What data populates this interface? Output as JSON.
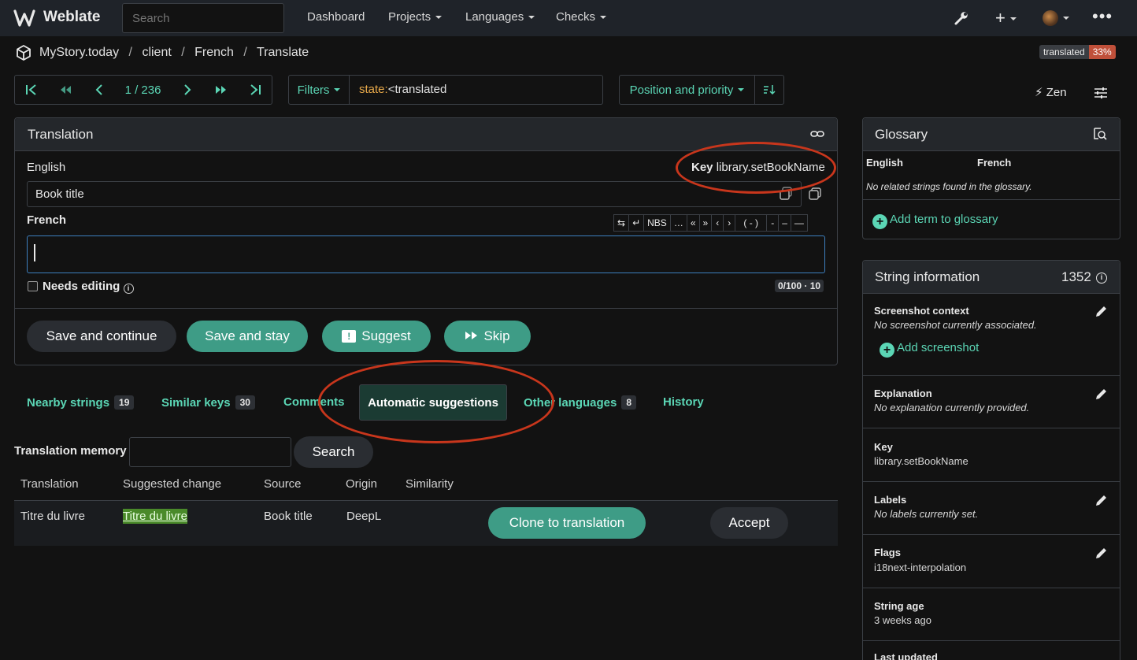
{
  "navbar": {
    "brand": "Weblate",
    "search_placeholder": "Search",
    "menu": [
      "Dashboard",
      "Projects",
      "Languages",
      "Checks"
    ]
  },
  "breadcrumb": [
    "MyStory.today",
    "client",
    "French",
    "Translate"
  ],
  "progress": {
    "label": "translated",
    "percent_text": "33%",
    "percent": 33
  },
  "nav_counter": "1 / 236",
  "filters": {
    "label": "Filters",
    "query_key": "state:",
    "query_value": "<translated"
  },
  "sort": {
    "label": "Position and priority"
  },
  "zen": {
    "label": "Zen"
  },
  "translation_panel": {
    "title": "Translation",
    "source_lang": "English",
    "key_label": "Key",
    "key_value": "library.setBookName",
    "source_text": "Book title",
    "target_lang": "French",
    "special_chars": [
      "⇆",
      "↵",
      "NBS",
      "…",
      "«",
      "»",
      "‹",
      "›",
      "( - )",
      "-",
      "–",
      "—"
    ],
    "needs_editing_label": "Needs editing",
    "char_counter": "0/100 · 10",
    "buttons": {
      "save_continue": "Save and continue",
      "save_stay": "Save and stay",
      "suggest": "Suggest",
      "skip": "Skip"
    }
  },
  "tabs": [
    {
      "label": "Nearby strings",
      "count": "19"
    },
    {
      "label": "Similar keys",
      "count": "30"
    },
    {
      "label": "Comments",
      "count": ""
    },
    {
      "label": "Automatic suggestions",
      "count": ""
    },
    {
      "label": "Other languages",
      "count": "8"
    },
    {
      "label": "History",
      "count": ""
    }
  ],
  "memory": {
    "label": "Translation memory",
    "search_button": "Search"
  },
  "suggestions_table": {
    "headers": [
      "Translation",
      "Suggested change",
      "Source",
      "Origin",
      "Similarity"
    ],
    "rows": [
      {
        "translation": "Titre du livre",
        "suggested": "Titre du livre",
        "source": "Book title",
        "origin": "DeepL",
        "clone_label": "Clone to translation",
        "accept_label": "Accept"
      }
    ]
  },
  "glossary": {
    "title": "Glossary",
    "col_source": "English",
    "col_target": "French",
    "empty": "No related strings found in the glossary.",
    "add_label": "Add term to glossary"
  },
  "string_info": {
    "title": "String information",
    "id": "1352",
    "screenshot_label": "Screenshot context",
    "screenshot_value": "No screenshot currently associated.",
    "add_screenshot": "Add screenshot",
    "explanation_label": "Explanation",
    "explanation_value": "No explanation currently provided.",
    "key_label": "Key",
    "key_value": "library.setBookName",
    "labels_label": "Labels",
    "labels_value": "No labels currently set.",
    "flags_label": "Flags",
    "flags_value": "i18next-interpolation",
    "age_label": "String age",
    "age_value": "3 weeks ago",
    "updated_label": "Last updated"
  },
  "colors": {
    "accent": "#5bd6b5",
    "button_green": "#3e9c86",
    "annotation": "#c8361c",
    "progress_red": "#c0503a"
  }
}
